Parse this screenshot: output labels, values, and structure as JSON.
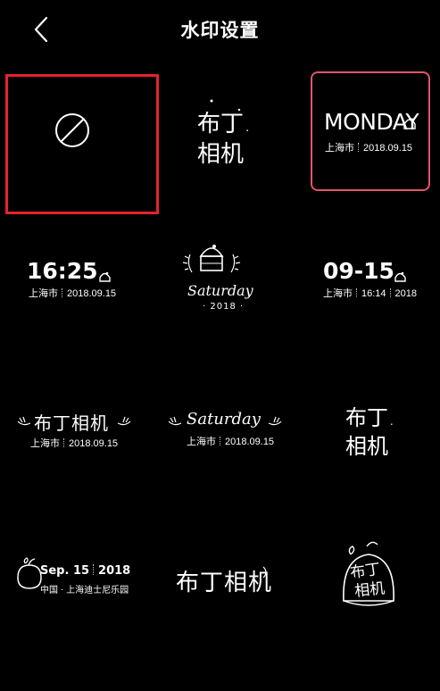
{
  "header": {
    "title": "水印设置",
    "back_icon": "chevron-left-icon"
  },
  "watermarks": {
    "w1": {
      "icon": "no-watermark-icon"
    },
    "w2": {
      "line1": "布丁.",
      "line2": "相机"
    },
    "w3": {
      "day": "MONDAY",
      "city": "上海市",
      "date": "2018.09.15"
    },
    "w4": {
      "time": "16:25",
      "city": "上海市",
      "date": "2018.09.15"
    },
    "w5": {
      "day": "Saturday",
      "year": "· 2018 ·"
    },
    "w6": {
      "date": "09-15",
      "city": "上海市",
      "time": "16:14",
      "year": "2018"
    },
    "w7": {
      "brand": "布丁相机",
      "city": "上海市",
      "date": "2018.09.15"
    },
    "w8": {
      "day": "Saturday",
      "city": "上海市",
      "date": "2018.09.15"
    },
    "w9": {
      "line1": "布丁.",
      "line2": "相机"
    },
    "w10": {
      "date": "Sep. 15",
      "year": "2018",
      "country": "中国",
      "place": "上海迪士尼乐园"
    },
    "w11": {
      "brand": "布丁相机"
    },
    "w12": {
      "line1": "布丁",
      "line2": "相机"
    }
  },
  "colors": {
    "background": "#000000",
    "selected_border": "#e5232e",
    "current_border": "#e0566a"
  }
}
